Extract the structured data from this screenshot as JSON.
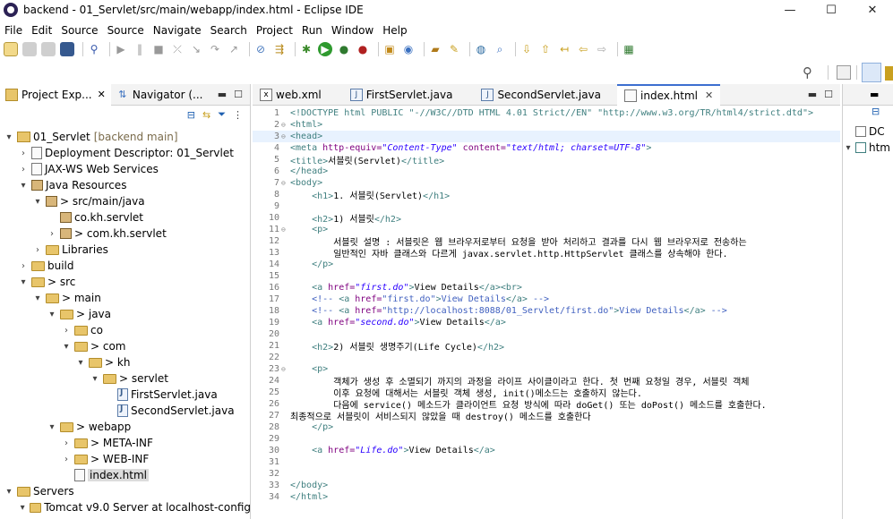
{
  "window": {
    "title": "backend - 01_Servlet/src/main/webapp/index.html - Eclipse IDE",
    "minimize": "—",
    "maximize": "☐",
    "close": "✕"
  },
  "menu": [
    "File",
    "Edit",
    "Source",
    "Source",
    "Navigate",
    "Search",
    "Project",
    "Run",
    "Window",
    "Help"
  ],
  "left_tabs": [
    {
      "label": "Project Exp...",
      "icon": "project-explorer-icon",
      "close": "✕"
    },
    {
      "label": "Navigator (...",
      "icon": "navigator-icon"
    }
  ],
  "tree": [
    {
      "label": "01_Servlet",
      "decoration": "[backend main]",
      "depth": 0,
      "twisty": "▾",
      "kind": "project"
    },
    {
      "label": "Deployment Descriptor: 01_Servlet",
      "depth": 1,
      "twisty": "›",
      "kind": "descriptor"
    },
    {
      "label": "JAX-WS Web Services",
      "depth": 1,
      "twisty": "›",
      "kind": "webservice"
    },
    {
      "label": "Java Resources",
      "depth": 1,
      "twisty": "▾",
      "kind": "javares"
    },
    {
      "label": "> src/main/java",
      "depth": 2,
      "twisty": "▾",
      "kind": "srcfolder"
    },
    {
      "label": "co.kh.servlet",
      "depth": 3,
      "twisty": "",
      "kind": "package"
    },
    {
      "label": "> com.kh.servlet",
      "depth": 3,
      "twisty": "›",
      "kind": "package"
    },
    {
      "label": "Libraries",
      "depth": 2,
      "twisty": "›",
      "kind": "library"
    },
    {
      "label": "build",
      "depth": 1,
      "twisty": "›",
      "kind": "folder"
    },
    {
      "label": "> src",
      "depth": 1,
      "twisty": "▾",
      "kind": "folder"
    },
    {
      "label": "> main",
      "depth": 2,
      "twisty": "▾",
      "kind": "folder"
    },
    {
      "label": "> java",
      "depth": 3,
      "twisty": "▾",
      "kind": "folder"
    },
    {
      "label": "co",
      "depth": 4,
      "twisty": "›",
      "kind": "folder"
    },
    {
      "label": "> com",
      "depth": 4,
      "twisty": "▾",
      "kind": "folder"
    },
    {
      "label": "> kh",
      "depth": 5,
      "twisty": "▾",
      "kind": "folder"
    },
    {
      "label": "> servlet",
      "depth": 6,
      "twisty": "▾",
      "kind": "folder"
    },
    {
      "label": "FirstServlet.java",
      "depth": 7,
      "twisty": "",
      "kind": "java"
    },
    {
      "label": "SecondServlet.java",
      "depth": 7,
      "twisty": "",
      "kind": "java"
    },
    {
      "label": "> webapp",
      "depth": 3,
      "twisty": "▾",
      "kind": "folder"
    },
    {
      "label": "> META-INF",
      "depth": 4,
      "twisty": "›",
      "kind": "folder"
    },
    {
      "label": "> WEB-INF",
      "depth": 4,
      "twisty": "›",
      "kind": "folder"
    },
    {
      "label": "index.html",
      "depth": 4,
      "twisty": "",
      "kind": "html",
      "selected": true
    },
    {
      "label": "Servers",
      "depth": 0,
      "twisty": "▾",
      "kind": "folder"
    },
    {
      "label": "Tomcat v9.0 Server at localhost-config",
      "depth": 1,
      "twisty": "▾",
      "kind": "folder"
    }
  ],
  "editor_tabs": [
    {
      "label": "web.xml",
      "icon": "xml-file-icon"
    },
    {
      "label": "FirstServlet.java",
      "icon": "java-file-icon"
    },
    {
      "label": "SecondServlet.java",
      "icon": "java-file-icon"
    },
    {
      "label": "index.html",
      "icon": "html-file-icon",
      "active": true,
      "close": "✕"
    }
  ],
  "code_lines": [
    {
      "n": "1",
      "fold": "",
      "parts": [
        [
          "dt",
          "<!DOCTYPE html PUBLIC \"-//W3C//DTD HTML 4.01 Strict//EN\" \"http://www.w3.org/TR/html4/strict.dtd\">"
        ]
      ]
    },
    {
      "n": "2",
      "fold": "⊖",
      "parts": [
        [
          "tag",
          "<html>"
        ]
      ]
    },
    {
      "n": "3",
      "fold": "⊖",
      "hl": true,
      "parts": [
        [
          "tag",
          "<head>"
        ]
      ]
    },
    {
      "n": "4",
      "fold": "",
      "parts": [
        [
          "tag",
          "<meta "
        ],
        [
          "at",
          "http-equiv="
        ],
        [
          "av",
          "\"Content-Type\""
        ],
        [
          "at",
          " content="
        ],
        [
          "av",
          "\"text/html; charset=UTF-8\""
        ],
        [
          "tag",
          ">"
        ]
      ]
    },
    {
      "n": "5",
      "fold": "",
      "parts": [
        [
          "tag",
          "<title>"
        ],
        [
          "txt",
          "서블릿(Servlet)"
        ],
        [
          "tag",
          "</title>"
        ]
      ]
    },
    {
      "n": "6",
      "fold": "",
      "parts": [
        [
          "tag",
          "</head>"
        ]
      ]
    },
    {
      "n": "7",
      "fold": "⊖",
      "parts": [
        [
          "tag",
          "<body>"
        ]
      ]
    },
    {
      "n": "8",
      "fold": "",
      "parts": [
        [
          "txt",
          "    "
        ],
        [
          "tag",
          "<h1>"
        ],
        [
          "txt",
          "1. 서블릿(Servlet)"
        ],
        [
          "tag",
          "</h1>"
        ]
      ]
    },
    {
      "n": "9",
      "fold": "",
      "parts": [
        [
          "txt",
          ""
        ]
      ]
    },
    {
      "n": "10",
      "fold": "",
      "parts": [
        [
          "txt",
          "    "
        ],
        [
          "tag",
          "<h2>"
        ],
        [
          "txt",
          "1) 서블릿"
        ],
        [
          "tag",
          "</h2>"
        ]
      ]
    },
    {
      "n": "11",
      "fold": "⊖",
      "parts": [
        [
          "txt",
          "    "
        ],
        [
          "tag",
          "<p>"
        ]
      ]
    },
    {
      "n": "12",
      "fold": "",
      "parts": [
        [
          "txt",
          "        서블릿 설명 : 서블릿은 웹 브라우저로부터 요청을 받아 처리하고 결과를 다시 웹 브라우저로 전송하는"
        ]
      ]
    },
    {
      "n": "13",
      "fold": "",
      "parts": [
        [
          "txt",
          "        일반적인 자바 클래스와 다르게 javax.servlet.http.HttpServlet 클래스를 상속해야 한다."
        ]
      ]
    },
    {
      "n": "14",
      "fold": "",
      "parts": [
        [
          "txt",
          "    "
        ],
        [
          "tag",
          "</p>"
        ]
      ]
    },
    {
      "n": "15",
      "fold": "",
      "parts": [
        [
          "txt",
          ""
        ]
      ]
    },
    {
      "n": "16",
      "fold": "",
      "parts": [
        [
          "txt",
          "    "
        ],
        [
          "tag",
          "<a "
        ],
        [
          "at",
          "href="
        ],
        [
          "av",
          "\"first.do\""
        ],
        [
          "tag",
          ">"
        ],
        [
          "txt",
          "View Details"
        ],
        [
          "tag",
          "</a><br>"
        ]
      ]
    },
    {
      "n": "17",
      "fold": "",
      "parts": [
        [
          "txt",
          "    "
        ],
        [
          "cm",
          "<!-- "
        ],
        [
          "tag",
          "<a "
        ],
        [
          "at",
          "href="
        ],
        [
          "cm",
          "\"first.do\""
        ],
        [
          "tag",
          ">"
        ],
        [
          "cm",
          "View Details"
        ],
        [
          "tag",
          "</a>"
        ],
        [
          "cm",
          " -->"
        ]
      ]
    },
    {
      "n": "18",
      "fold": "",
      "parts": [
        [
          "txt",
          "    "
        ],
        [
          "cm",
          "<!-- "
        ],
        [
          "tag",
          "<a "
        ],
        [
          "at",
          "href="
        ],
        [
          "cm",
          "\"http://localhost:8088/01_Servlet/first.do\""
        ],
        [
          "tag",
          ">"
        ],
        [
          "cm",
          "View Details"
        ],
        [
          "tag",
          "</a>"
        ],
        [
          "cm",
          " -->"
        ]
      ]
    },
    {
      "n": "19",
      "fold": "",
      "parts": [
        [
          "txt",
          "    "
        ],
        [
          "tag",
          "<a "
        ],
        [
          "at",
          "href="
        ],
        [
          "av",
          "\"second.do\""
        ],
        [
          "tag",
          ">"
        ],
        [
          "txt",
          "View Details"
        ],
        [
          "tag",
          "</a>"
        ]
      ]
    },
    {
      "n": "20",
      "fold": "",
      "parts": [
        [
          "txt",
          ""
        ]
      ]
    },
    {
      "n": "21",
      "fold": "",
      "parts": [
        [
          "txt",
          "    "
        ],
        [
          "tag",
          "<h2>"
        ],
        [
          "txt",
          "2) 서블릿 생명주기(Life Cycle)"
        ],
        [
          "tag",
          "</h2>"
        ]
      ]
    },
    {
      "n": "22",
      "fold": "",
      "parts": [
        [
          "txt",
          ""
        ]
      ]
    },
    {
      "n": "23",
      "fold": "⊖",
      "parts": [
        [
          "txt",
          "    "
        ],
        [
          "tag",
          "<p>"
        ]
      ]
    },
    {
      "n": "24",
      "fold": "",
      "parts": [
        [
          "txt",
          "        객체가 생성 후 소멸되기 까지의 과정을 라이프 사이클이라고 한다. 첫 번째 요청일 경우, 서블릿 객체"
        ]
      ]
    },
    {
      "n": "25",
      "fold": "",
      "parts": [
        [
          "txt",
          "        이후 요청에 대해서는 서블릿 객체 생성, init()메소드는 호출하지 않는다."
        ]
      ]
    },
    {
      "n": "26",
      "fold": "",
      "parts": [
        [
          "txt",
          "        다음에 service() 메소드가 클라이언트 요청 방식에 따라 doGet() 또는 doPost() 메소드를 호출한다."
        ]
      ]
    },
    {
      "n": "27",
      "fold": "",
      "parts": [
        [
          "txt",
          "최종적으로 서블릿이 서비스되지 않았을 때 destroy() 메소드를 호출한다"
        ]
      ]
    },
    {
      "n": "28",
      "fold": "",
      "parts": [
        [
          "txt",
          "    "
        ],
        [
          "tag",
          "</p>"
        ]
      ]
    },
    {
      "n": "29",
      "fold": "",
      "parts": [
        [
          "txt",
          ""
        ]
      ]
    },
    {
      "n": "30",
      "fold": "",
      "parts": [
        [
          "txt",
          "    "
        ],
        [
          "tag",
          "<a "
        ],
        [
          "at",
          "href="
        ],
        [
          "av",
          "\"Life.do\""
        ],
        [
          "tag",
          ">"
        ],
        [
          "txt",
          "View Details"
        ],
        [
          "tag",
          "</a>"
        ]
      ]
    },
    {
      "n": "31",
      "fold": "",
      "parts": [
        [
          "txt",
          ""
        ]
      ]
    },
    {
      "n": "32",
      "fold": "",
      "parts": [
        [
          "txt",
          ""
        ]
      ]
    },
    {
      "n": "33",
      "fold": "",
      "parts": [
        [
          "tag",
          "</body>"
        ]
      ]
    },
    {
      "n": "34",
      "fold": "",
      "parts": [
        [
          "tag",
          "</html>"
        ]
      ]
    }
  ],
  "right_panel": {
    "items": [
      "DC",
      "htm"
    ]
  },
  "colors": {
    "tag": "#3f7f7f",
    "attr": "#7f007f",
    "value": "#2a00ff",
    "comment": "#3f5fbf",
    "accent": "#3c6fd0"
  }
}
